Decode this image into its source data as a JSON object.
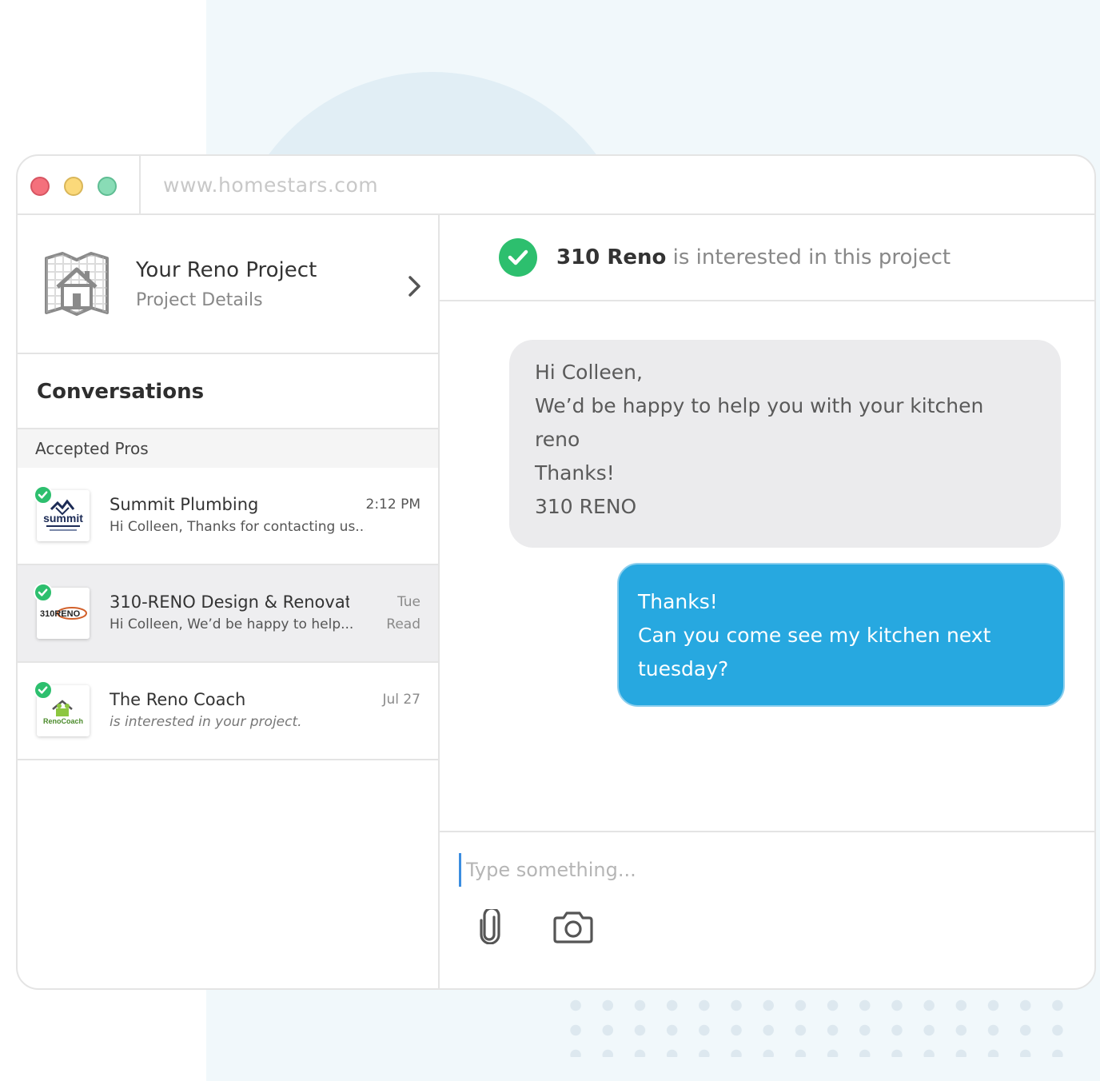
{
  "browser": {
    "url": "www.homestars.com"
  },
  "project": {
    "title": "Your Reno Project",
    "subtitle": "Project Details"
  },
  "conversations": {
    "heading": "Conversations",
    "section_label": "Accepted Pros",
    "items": [
      {
        "name": "Summit Plumbing",
        "preview": "Hi Colleen, Thanks for contacting us...",
        "time": "2:12 PM",
        "status": "",
        "logo_text": "summit"
      },
      {
        "name": "310-RENO Design & Renovat...",
        "preview": "Hi Colleen, We’d be happy to help...",
        "time": "Tue",
        "status": "Read",
        "logo_text": "310RENO"
      },
      {
        "name": "The Reno Coach",
        "preview": "is interested in your project.",
        "time": "Jul 27",
        "status": "",
        "logo_text": "RenoCoach"
      }
    ]
  },
  "chat": {
    "header_company": "310 Reno",
    "header_text": " is interested in this project",
    "messages": [
      {
        "direction": "incoming",
        "text": "Hi Colleen,\nWe’d be happy to help you with your kitchen\nreno\nThanks!\n310 RENO"
      },
      {
        "direction": "outgoing",
        "text": "Thanks!\nCan you come see my kitchen next\ntuesday?"
      }
    ],
    "composer": {
      "placeholder": "Type something...",
      "attach_icon": "paperclip-icon",
      "camera_icon": "camera-icon"
    }
  },
  "colors": {
    "accent_blue": "#27a8e0",
    "success_green": "#2dbf6e",
    "incoming_bubble": "#ebebed"
  }
}
